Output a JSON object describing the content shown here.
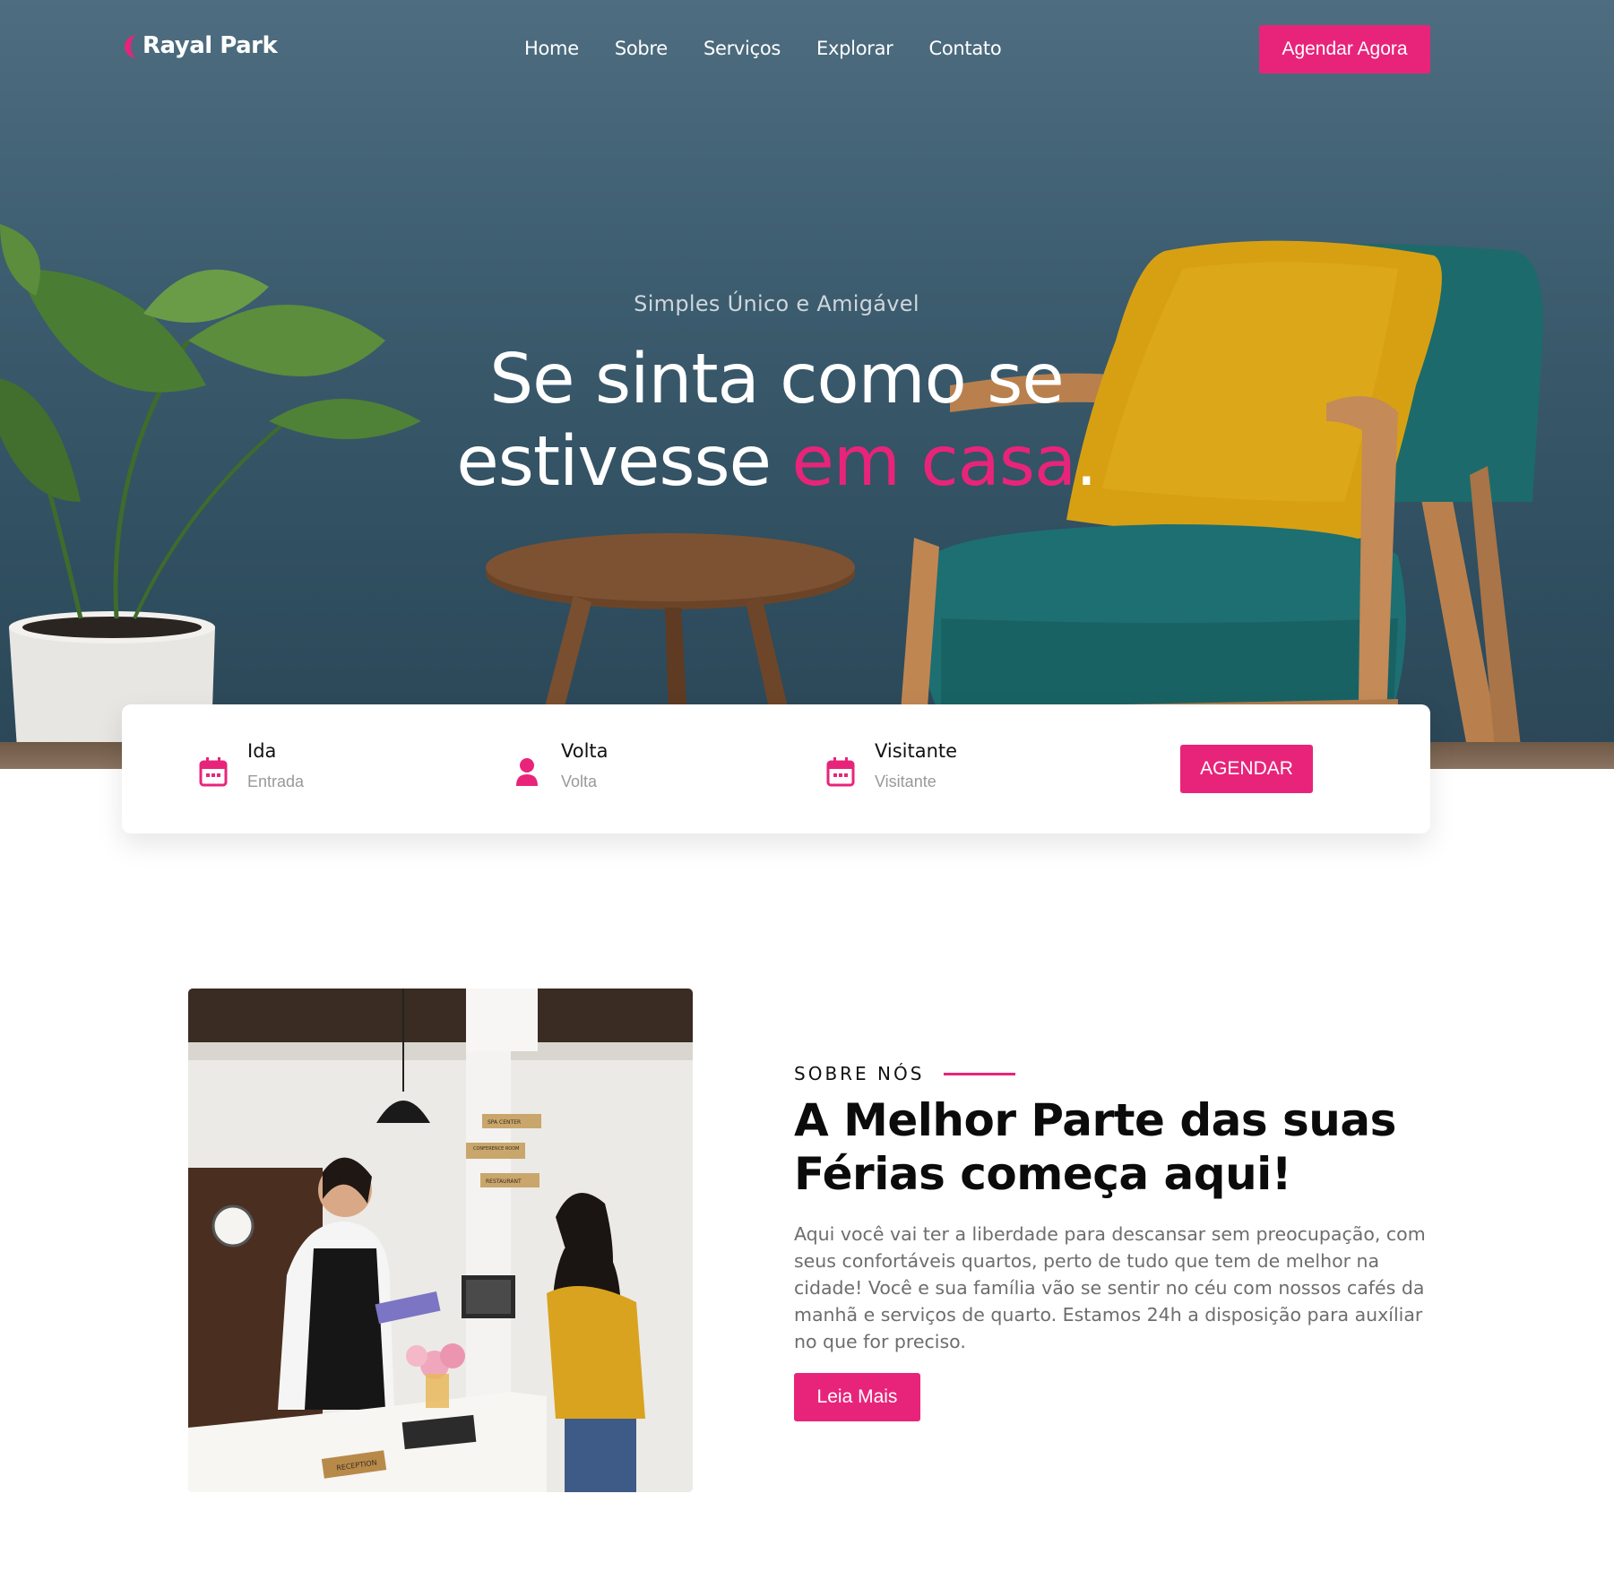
{
  "header": {
    "logo_text": "Rayal Park",
    "nav": [
      "Home",
      "Sobre",
      "Serviços",
      "Explorar",
      "Contato"
    ],
    "cta_label": "Agendar Agora"
  },
  "hero": {
    "kicker": "Simples Único e Amigável",
    "title_line1": "Se sinta como se",
    "title_line2_plain": "estivesse ",
    "title_line2_accent": "em casa",
    "title_line2_end": "."
  },
  "booking": {
    "items": [
      {
        "label": "Ida",
        "placeholder": "Entrada",
        "icon": "calendar-icon"
      },
      {
        "label": "Volta",
        "placeholder": "Volta",
        "icon": "user-icon"
      },
      {
        "label": "Visitante",
        "placeholder": "Visitante",
        "icon": "calendar-icon"
      }
    ],
    "submit_label": "AGENDAR"
  },
  "about": {
    "kicker": "SOBRE NÓS",
    "title": "A Melhor Parte das suas Férias começa aqui!",
    "text": "Aqui você vai ter a liberdade para descansar sem preocupação, com seus confortáveis quartos, perto de tudo que tem de melhor na cidade! Você e sua família vão se sentir no céu com nossos cafés da manhã e serviços de quarto. Estamos 24h a disposição para auxíliar no que for preciso.",
    "button_label": "Leia Mais",
    "image_signs": [
      "SPA CENTER",
      "CONFERENCE ROOM",
      "RESTAURANT",
      "RECEPTION"
    ]
  },
  "colors": {
    "accent": "#e8247a",
    "hero_wall": "#3d5d70"
  }
}
